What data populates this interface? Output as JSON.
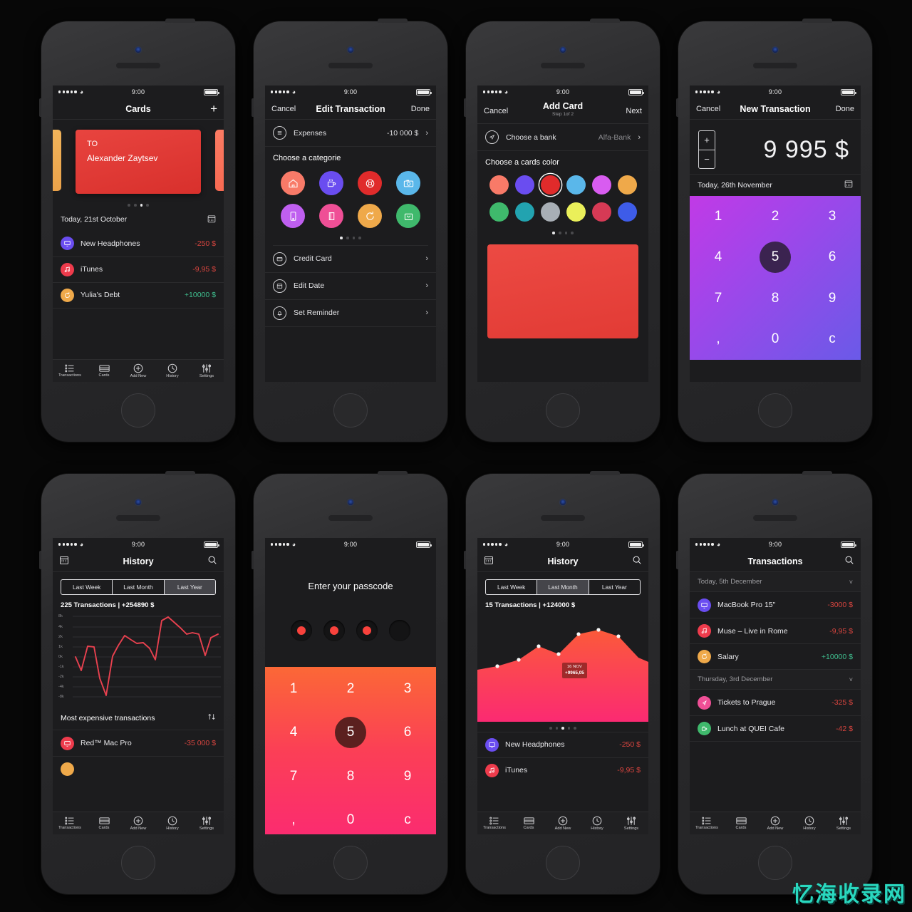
{
  "meta": {
    "watermark": "忆海收录网"
  },
  "status_bar": {
    "time": "9:00"
  },
  "tabbar": {
    "items": [
      {
        "label": "Transactions",
        "icon": "list-icon"
      },
      {
        "label": "Cards",
        "icon": "card-icon"
      },
      {
        "label": "Add New",
        "icon": "plus-circle-icon"
      },
      {
        "label": "History",
        "icon": "clock-icon"
      },
      {
        "label": "Settings",
        "icon": "sliders-icon"
      }
    ]
  },
  "screens": {
    "cards": {
      "nav": {
        "title": "Cards",
        "add": "+"
      },
      "card": {
        "to_label": "TO",
        "name": "Alexander Zaytsev",
        "color": "#e0362f"
      },
      "pager": {
        "count": 4,
        "active": 2
      },
      "date": {
        "label": "Today, 21st October",
        "icon": "calendar-icon"
      },
      "transactions": [
        {
          "name": "New Headphones",
          "amount": "-250 $",
          "sign": "neg",
          "color": "#6a4df0",
          "icon": "monitor-icon"
        },
        {
          "name": "iTunes",
          "amount": "-9,95 $",
          "sign": "neg",
          "color": "#ee3b4c",
          "icon": "music-icon"
        },
        {
          "name": "Yulia's Debt",
          "amount": "+10000 $",
          "sign": "pos",
          "color": "#efa94a",
          "icon": "refresh-icon"
        }
      ]
    },
    "edit_transaction": {
      "nav": {
        "left": "Cancel",
        "title": "Edit Transaction",
        "right": "Done"
      },
      "expenses": {
        "label": "Expenses",
        "value": "-10 000 $",
        "icon": "menu-icon"
      },
      "categories_label": "Choose a categorie",
      "categories": [
        {
          "name": "home",
          "color": "#f87a68",
          "icon": "home-icon"
        },
        {
          "name": "cafe",
          "color": "#6a4df0",
          "icon": "coffee-icon"
        },
        {
          "name": "health",
          "color": "#e02b2b",
          "icon": "lifebuoy-icon"
        },
        {
          "name": "photo",
          "color": "#5ab7ea",
          "icon": "camera-icon"
        },
        {
          "name": "mobile",
          "color": "#bf5ff0",
          "icon": "phone-icon"
        },
        {
          "name": "books",
          "color": "#ef4f96",
          "icon": "book-icon"
        },
        {
          "name": "debt",
          "color": "#efa94a",
          "icon": "refresh-icon"
        },
        {
          "name": "shopping",
          "color": "#3fb96c",
          "icon": "bag-icon"
        }
      ],
      "pager": {
        "count": 4,
        "active": 0
      },
      "rows": [
        {
          "label": "Credit Card",
          "icon": "credit-card-icon"
        },
        {
          "label": "Edit Date",
          "icon": "calendar-icon"
        },
        {
          "label": "Set Reminder",
          "icon": "bell-icon"
        }
      ]
    },
    "add_card": {
      "nav": {
        "left": "Cancel",
        "title": "Add Card",
        "subtitle": "Step 1of 2",
        "right": "Next"
      },
      "bank_row": {
        "label": "Choose a bank",
        "value": "Alfa-Bank",
        "icon": "navigation-icon"
      },
      "color_label": "Choose a cards color",
      "colors": [
        {
          "hex": "#f87a68",
          "selected": false
        },
        {
          "hex": "#6a4df0",
          "selected": false
        },
        {
          "hex": "#e02b2b",
          "selected": true
        },
        {
          "hex": "#5ab7ea",
          "selected": false
        },
        {
          "hex": "#d85cf0",
          "selected": false
        },
        {
          "hex": "#efa94a",
          "selected": false
        },
        {
          "hex": "#3fb96c",
          "selected": false
        },
        {
          "hex": "#22a3b0",
          "selected": false
        },
        {
          "hex": "#a8aeb5",
          "selected": false
        },
        {
          "hex": "#eaef5a",
          "selected": false
        },
        {
          "hex": "#d63a55",
          "selected": false
        },
        {
          "hex": "#3e5ce8",
          "selected": false
        }
      ],
      "pager": {
        "count": 4,
        "active": 0
      },
      "preview_color": "#e8433c"
    },
    "new_transaction": {
      "nav": {
        "left": "Cancel",
        "title": "New Transaction",
        "right": "Done"
      },
      "amount": "9 995 $",
      "stepper": {
        "plus": "+",
        "minus": "−"
      },
      "date": {
        "label": "Today, 26th November",
        "icon": "calendar-icon"
      },
      "keypad": {
        "keys": [
          "1",
          "2",
          "3",
          "4",
          "5",
          "6",
          "7",
          "8",
          "9",
          ",",
          "0",
          "c"
        ],
        "selected": "5"
      }
    },
    "history_year": {
      "nav": {
        "title": "History",
        "left_icon": "calendar-icon",
        "right_icon": "search-icon"
      },
      "segments": [
        {
          "label": "Last Week",
          "active": false
        },
        {
          "label": "Last Month",
          "active": false
        },
        {
          "label": "Last Year",
          "active": true
        }
      ],
      "summary": "225 Transactions | +254890 $",
      "most_expensive": {
        "label": "Most expensive transactions",
        "icon": "sort-icon"
      },
      "rows": [
        {
          "name": "Red™ Mac Pro",
          "amount": "-35 000 $",
          "sign": "neg",
          "color": "#ee3b4c",
          "icon": "monitor-icon"
        }
      ]
    },
    "passcode": {
      "title": "Enter your passcode",
      "dots_total": 4,
      "dots_filled": 3,
      "keypad": {
        "keys": [
          "1",
          "2",
          "3",
          "4",
          "5",
          "6",
          "7",
          "8",
          "9",
          ",",
          "0",
          "c"
        ],
        "selected": "5"
      }
    },
    "history_month": {
      "nav": {
        "title": "History",
        "left_icon": "calendar-icon",
        "right_icon": "search-icon"
      },
      "segments": [
        {
          "label": "Last Week",
          "active": false
        },
        {
          "label": "Last Month",
          "active": true
        },
        {
          "label": "Last Year",
          "active": false
        }
      ],
      "summary": "15 Transactions | +124000 $",
      "tooltip": {
        "date": "16 NOV",
        "value": "+9965,05"
      },
      "pager": {
        "count": 5,
        "active": 2
      },
      "transactions": [
        {
          "name": "New Headphones",
          "amount": "-250 $",
          "sign": "neg",
          "color": "#6a4df0",
          "icon": "monitor-icon"
        },
        {
          "name": "iTunes",
          "amount": "-9,95 $",
          "sign": "neg",
          "color": "#ee3b4c",
          "icon": "music-icon"
        }
      ]
    },
    "transactions": {
      "nav": {
        "title": "Transactions",
        "left_icon": "calendar-icon",
        "right_icon": "search-icon"
      },
      "groups": [
        {
          "header": "Today, 5th December",
          "items": [
            {
              "name": "MacBook Pro 15\"",
              "amount": "-3000 $",
              "sign": "neg",
              "color": "#6a4df0",
              "icon": "monitor-icon"
            },
            {
              "name": "Muse – Live in Rome",
              "amount": "-9,95 $",
              "sign": "neg",
              "color": "#ee3b4c",
              "icon": "music-icon"
            },
            {
              "name": "Salary",
              "amount": "+10000 $",
              "sign": "pos",
              "color": "#efa94a",
              "icon": "refresh-icon"
            }
          ]
        },
        {
          "header": "Thursday, 3rd December",
          "items": [
            {
              "name": "Tickets to Prague",
              "amount": "-325 $",
              "sign": "neg",
              "color": "#ef4f96",
              "icon": "navigation-icon"
            },
            {
              "name": "Lunch at QUEI Cafe",
              "amount": "-42 $",
              "sign": "neg",
              "color": "#3fb96c",
              "icon": "coffee-icon"
            }
          ]
        }
      ]
    }
  },
  "chart_data": [
    {
      "id": "history_year_line",
      "type": "line",
      "title": "225 Transactions | +254890 $",
      "ylabel": "",
      "xlabel": "",
      "grid": true,
      "legend": "none",
      "ytick_labels": [
        "8k",
        "4k",
        "2k",
        "1k",
        "0k",
        "-1k",
        "-2k",
        "-4k",
        "-8k"
      ],
      "ytick_positions": [
        8000,
        4000,
        2000,
        1000,
        0,
        -1000,
        -2000,
        -4000,
        -8000
      ],
      "ylim": [
        -8000,
        8000
      ],
      "line_color": "#e8414f",
      "x": [
        0,
        1,
        2,
        3,
        4,
        5,
        6,
        7,
        8,
        9,
        10,
        11,
        12,
        13,
        14,
        15,
        16,
        17,
        18,
        19,
        20,
        21,
        22,
        23
      ],
      "values": [
        0,
        -1300,
        1200,
        1150,
        -3000,
        -6800,
        -200,
        1300,
        2600,
        2200,
        1700,
        1800,
        1000,
        -400,
        5500,
        7000,
        6200,
        5200,
        4000,
        4200,
        4000,
        200,
        3100,
        3600
      ]
    },
    {
      "id": "history_month_area",
      "type": "area",
      "title": "15 Transactions | +124000 $",
      "ylabel": "",
      "xlabel": "",
      "grid": false,
      "legend": "none",
      "fill_gradient": [
        "#fb5a3a",
        "#fb2a72"
      ],
      "point_color": "#ffffff",
      "annotation": {
        "date": "16 NOV",
        "value": "+9965,05",
        "point_index": 4
      },
      "x": [
        "1",
        "2",
        "3",
        "4",
        "5",
        "6",
        "7",
        "8",
        "9"
      ],
      "values": [
        3200,
        5400,
        5900,
        7600,
        6300,
        9000,
        9965,
        8600,
        5200
      ],
      "ylim": [
        0,
        11000
      ]
    }
  ]
}
